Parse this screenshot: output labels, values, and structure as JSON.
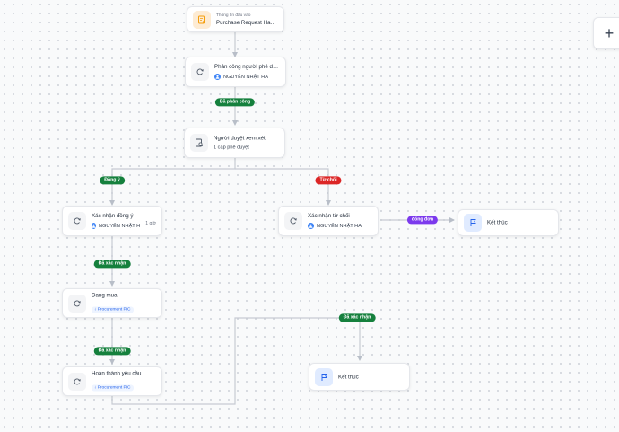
{
  "canvas": {
    "add_button_label": "+"
  },
  "nodes": {
    "start": {
      "label": "Thông tin đầu vào",
      "title": "Purchase Request Handling",
      "icon": "input-form-icon"
    },
    "assign": {
      "title": "Phân công người phê du...",
      "assignee": "NGUYỄN NHẬT HA",
      "icon": "loop-icon"
    },
    "review": {
      "title": "Người duyệt xem xét",
      "detail": "1 cấp phê duyệt",
      "icon": "document-review-icon"
    },
    "confirm_approve": {
      "title": "Xác nhận đồng ý",
      "assignee": "NGUYỄN NHẬT H",
      "duration": "1 giờ",
      "icon": "loop-icon"
    },
    "confirm_reject": {
      "title": "Xác nhận từ chối",
      "assignee": "NGUYỄN NHẬT HA",
      "icon": "loop-icon"
    },
    "end_top": {
      "title": "Kết thúc",
      "icon": "flag-icon"
    },
    "buying": {
      "title": "Đang mua",
      "tag": "Procurement PIC",
      "icon": "loop-icon"
    },
    "complete": {
      "title": "Hoàn thành yêu cầu",
      "tag": "Procurement PIC",
      "icon": "loop-icon"
    },
    "end_bottom": {
      "title": "Kết thúc",
      "icon": "flag-icon"
    }
  },
  "edge_labels": {
    "assigned": "Đã phân công",
    "approve": "Đồng ý",
    "reject": "Từ chối",
    "closed": "đóng đơn",
    "confirmed_1": "Đã xác nhận",
    "confirmed_2": "Đã xác nhận",
    "confirmed_3": "Đã xác nhận"
  },
  "colors": {
    "success": "#15803d",
    "danger": "#dc2626",
    "purple": "#7c3aed",
    "accent": "#2563eb",
    "edge": "#c7cbd3"
  }
}
